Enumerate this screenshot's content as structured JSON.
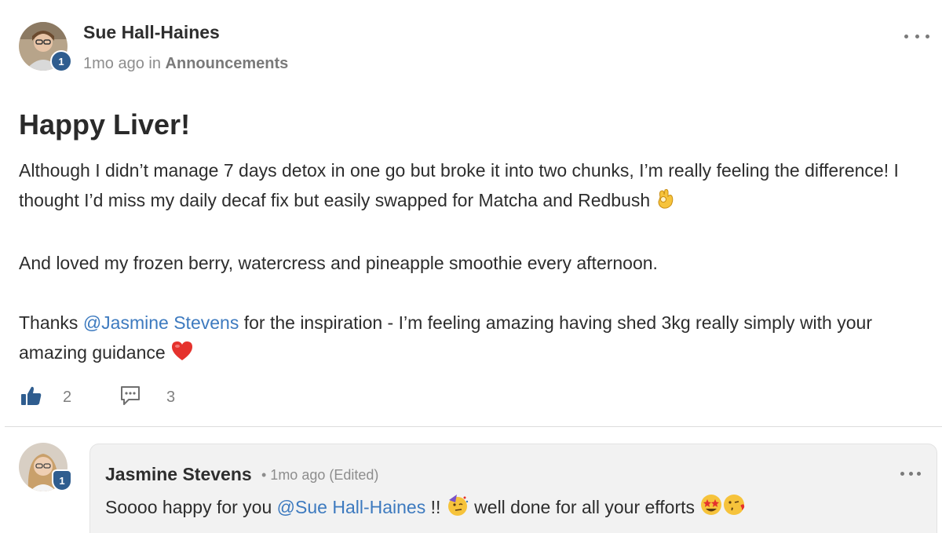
{
  "post": {
    "author": "Sue Hall-Haines",
    "author_level": "1",
    "time_ago": "1mo ago",
    "in_label": "in",
    "category": "Announcements",
    "title": "Happy Liver!",
    "paragraph1": "Although I didn’t manage 7 days detox in one go but broke it into two chunks, I’m really feeling the difference! I thought I’d miss my daily decaf fix but easily swapped for Matcha and Redbush",
    "paragraph2": "And loved my frozen berry, watercress and pineapple smoothie every afternoon.",
    "paragraph3_before": "Thanks ",
    "paragraph3_mention": "@Jasmine Stevens",
    "paragraph3_after": " for the inspiration - I’m feeling amazing having shed 3kg really simply with your amazing guidance",
    "like_count": "2",
    "comment_count": "3"
  },
  "icons": {
    "more": "more-horizontal-icon",
    "like": "thumbs-up-icon",
    "comment": "comment-bubble-icon",
    "ok_hand": "ok-hand-emoji",
    "heart": "red-heart-emoji",
    "party": "partying-face-emoji",
    "star_struck": "star-struck-emoji",
    "kiss": "face-blowing-kiss-emoji"
  },
  "comment": {
    "author": "Jasmine Stevens",
    "author_level": "1",
    "meta": "• 1mo ago (Edited)",
    "text_before": "Soooo happy for you ",
    "mention": "@Sue Hall-Haines",
    "text_middle": " !! ",
    "text_after": " well done for all your efforts "
  },
  "colors": {
    "mention": "#3d7abf",
    "like_icon": "#2f5d8f",
    "badge": "#2f5d8f",
    "comment_bg": "#f2f2f2"
  }
}
